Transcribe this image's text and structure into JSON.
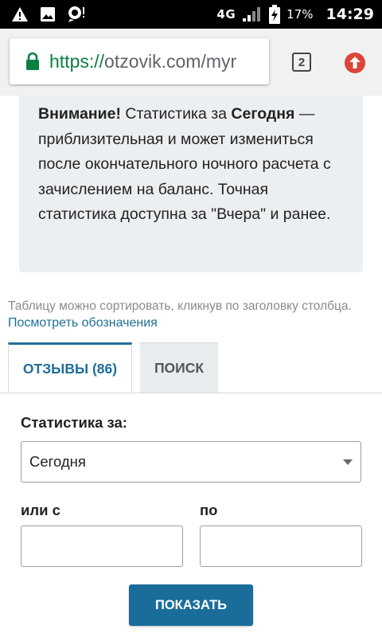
{
  "statusbar": {
    "network": "4G",
    "battery_percent": "17%",
    "time": "14:29",
    "icons": [
      "warning-icon",
      "image-icon",
      "notification-icon",
      "signal-icon",
      "battery-charging-icon"
    ]
  },
  "browser": {
    "url_scheme": "https://",
    "url_rest": "otzovik.com/myr",
    "tab_count": "2",
    "colors": {
      "secure": "#0b8043",
      "update": "#db4437"
    }
  },
  "notice": {
    "bold1": "Внимание!",
    "text1": " Статистика за ",
    "bold2": "Сегодня",
    "text2": " — приблизительная и может измениться после окончательного ночного расчета с зачислением на баланс. Точная статистика доступна за \"Вчера\" и ранее."
  },
  "hint": "Таблицу можно сортировать, кликнув по заголовку столбца.",
  "legend_link": "Посмотреть обозначения",
  "tabs": [
    {
      "label": "Отзывы (86)",
      "active": true
    },
    {
      "label": "Поиск",
      "active": false
    }
  ],
  "form": {
    "period_label": "Статистика за:",
    "period_value": "Сегодня",
    "from_label": "или с",
    "to_label": "по",
    "from_value": "",
    "to_value": "",
    "submit_label": "Показать"
  },
  "colors": {
    "accent": "#1a6d9b",
    "notice_bg": "#eceff1"
  }
}
